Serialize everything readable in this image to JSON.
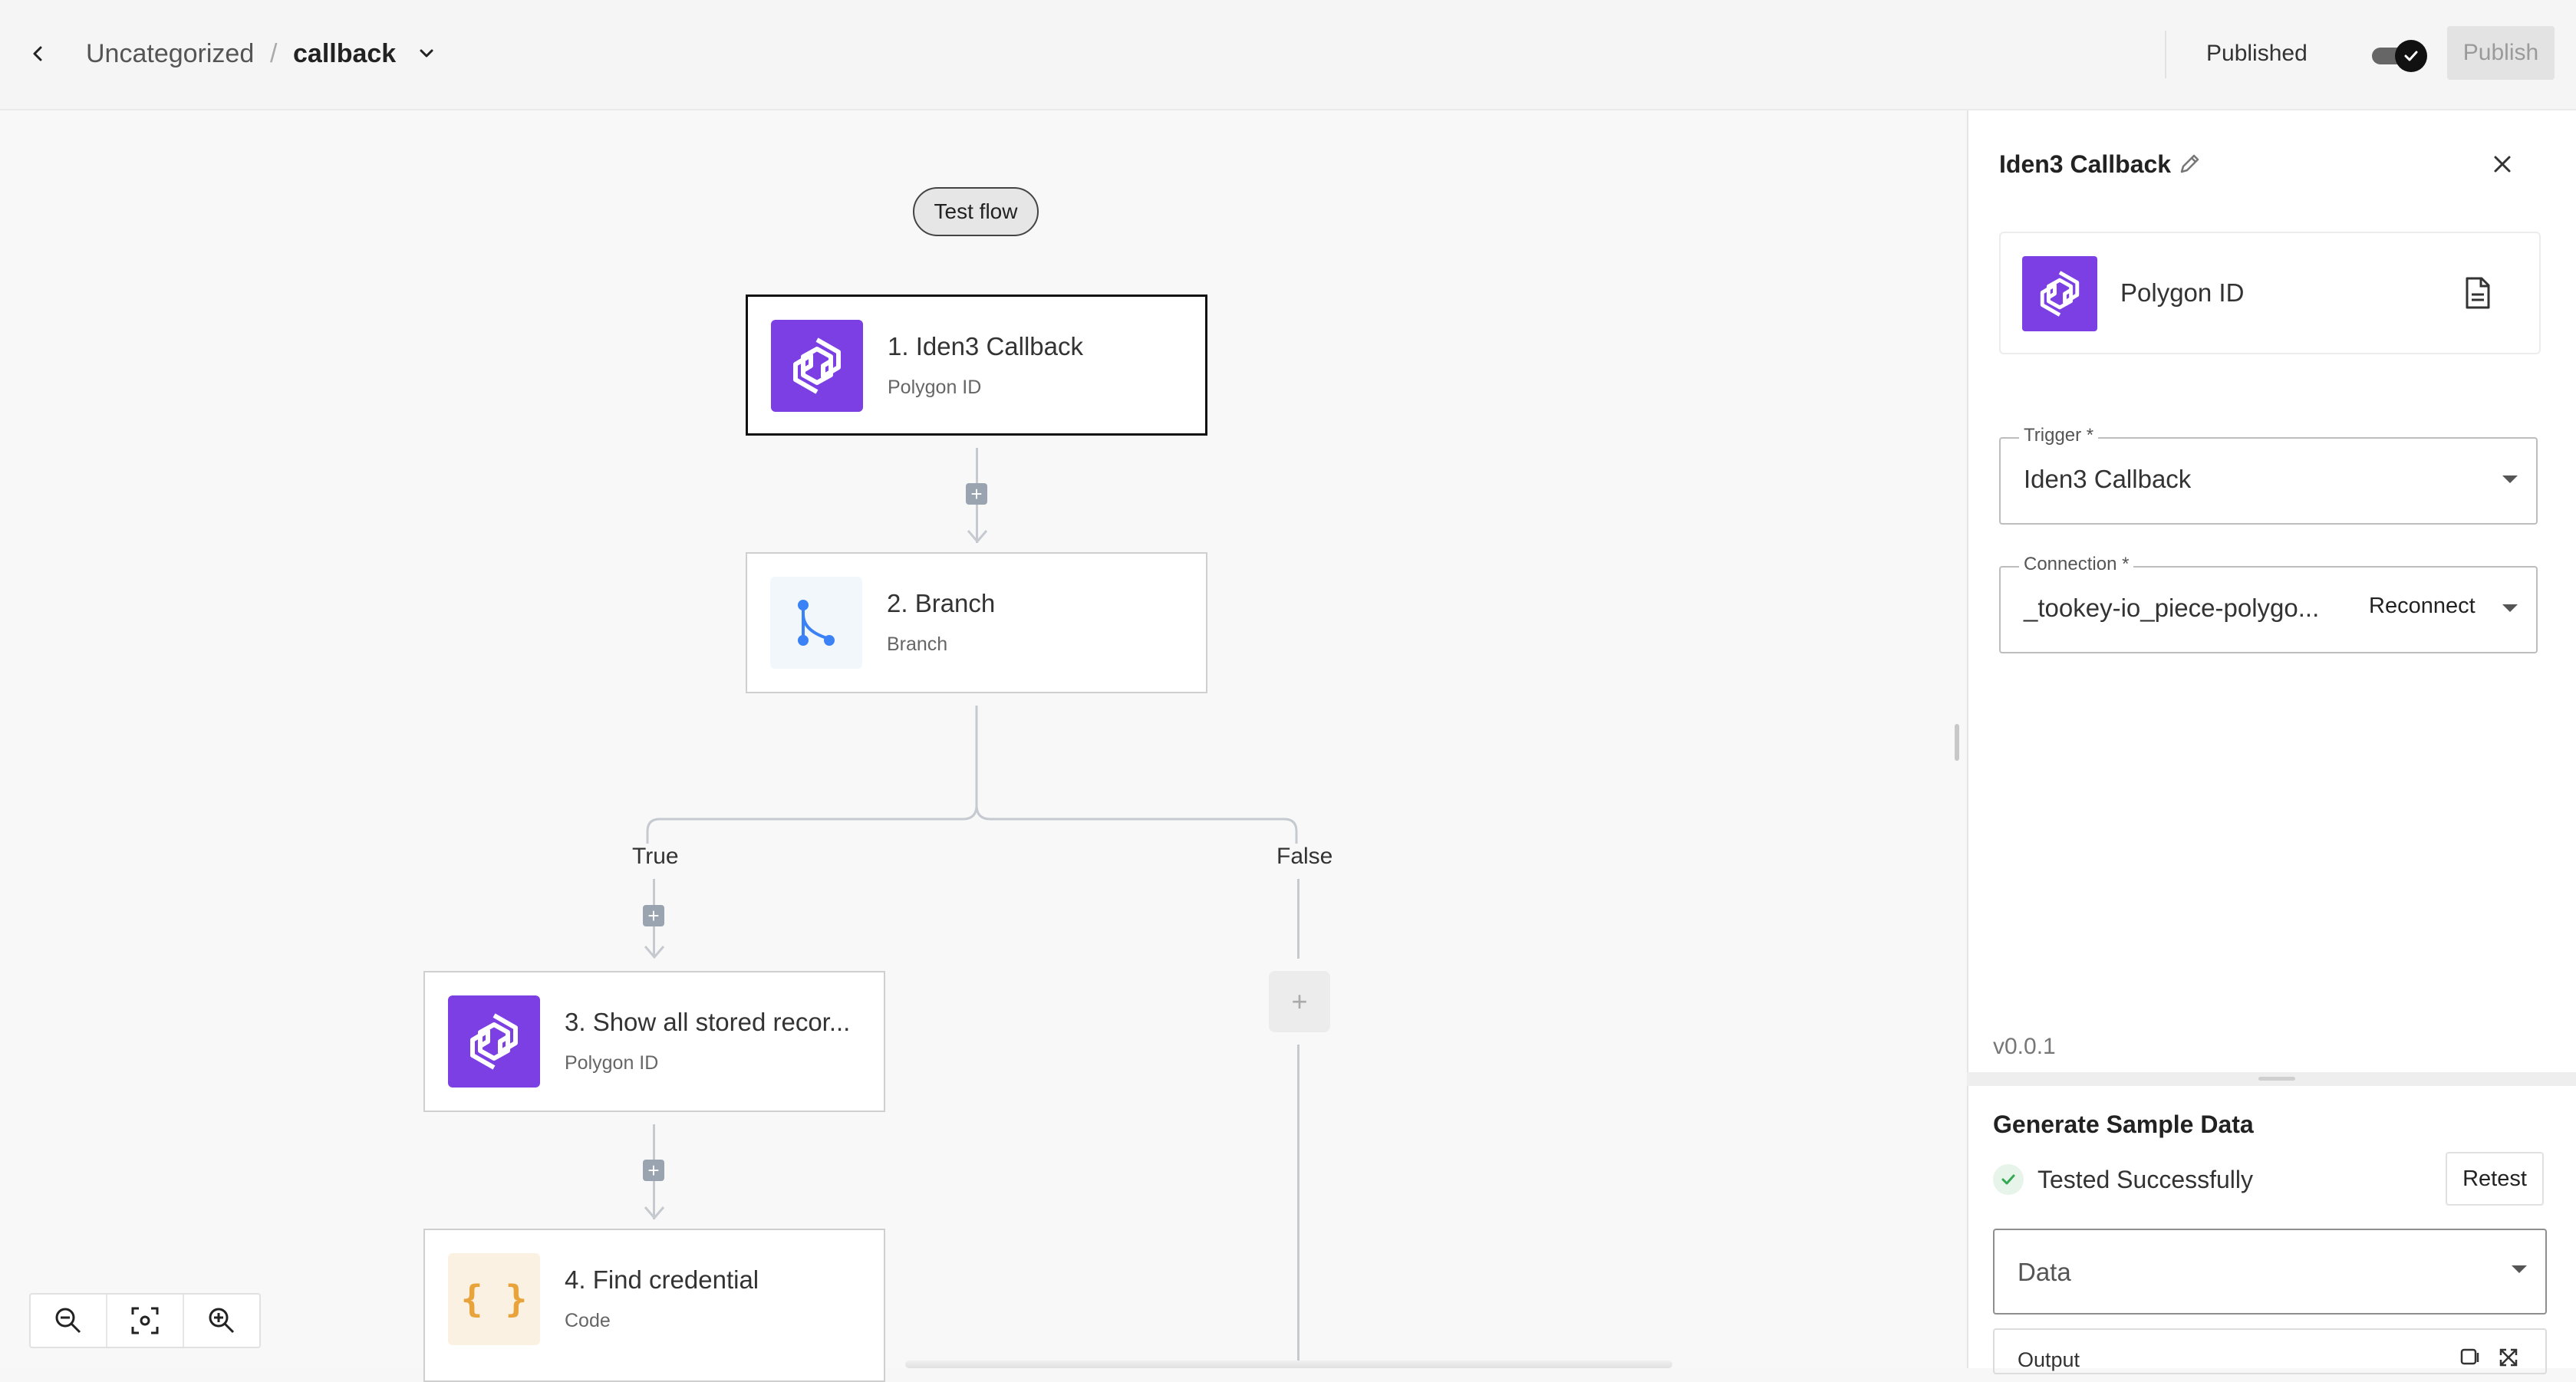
{
  "header": {
    "breadcrumb_folder": "Uncategorized",
    "breadcrumb_separator": "/",
    "flow_name": "callback",
    "published_label": "Published",
    "publish_button": "Publish"
  },
  "canvas": {
    "test_flow_button": "Test flow",
    "nodes": [
      {
        "title": "1. Iden3 Callback",
        "subtitle": "Polygon ID",
        "icon": "polygon-id-icon"
      },
      {
        "title": "2. Branch",
        "subtitle": "Branch",
        "icon": "branch-icon"
      },
      {
        "title": "3. Show all stored recor...",
        "subtitle": "Polygon ID",
        "icon": "polygon-id-icon"
      },
      {
        "title": "4. Find credential",
        "subtitle": "Code",
        "icon": "code-icon"
      }
    ],
    "branch_true_label": "True",
    "branch_false_label": "False",
    "add_step_symbol": "+",
    "code_icon_glyph": "{ }"
  },
  "panel": {
    "title": "Iden3 Callback",
    "piece_name": "Polygon ID",
    "trigger_label": "Trigger *",
    "trigger_value": "Iden3 Callback",
    "connection_label": "Connection *",
    "connection_value": "_tookey-io_piece-polygo...",
    "reconnect_label": "Reconnect",
    "version": "v0.0.1",
    "sample_title": "Generate Sample Data",
    "test_status": "Tested Successfully",
    "retest_button": "Retest",
    "data_select": "Data",
    "output_label": "Output"
  },
  "colors": {
    "polygon_purple": "#7b3fe4",
    "branch_blue": "#3b82f6",
    "code_amber": "#e8a43a",
    "success_green": "#34a853"
  }
}
